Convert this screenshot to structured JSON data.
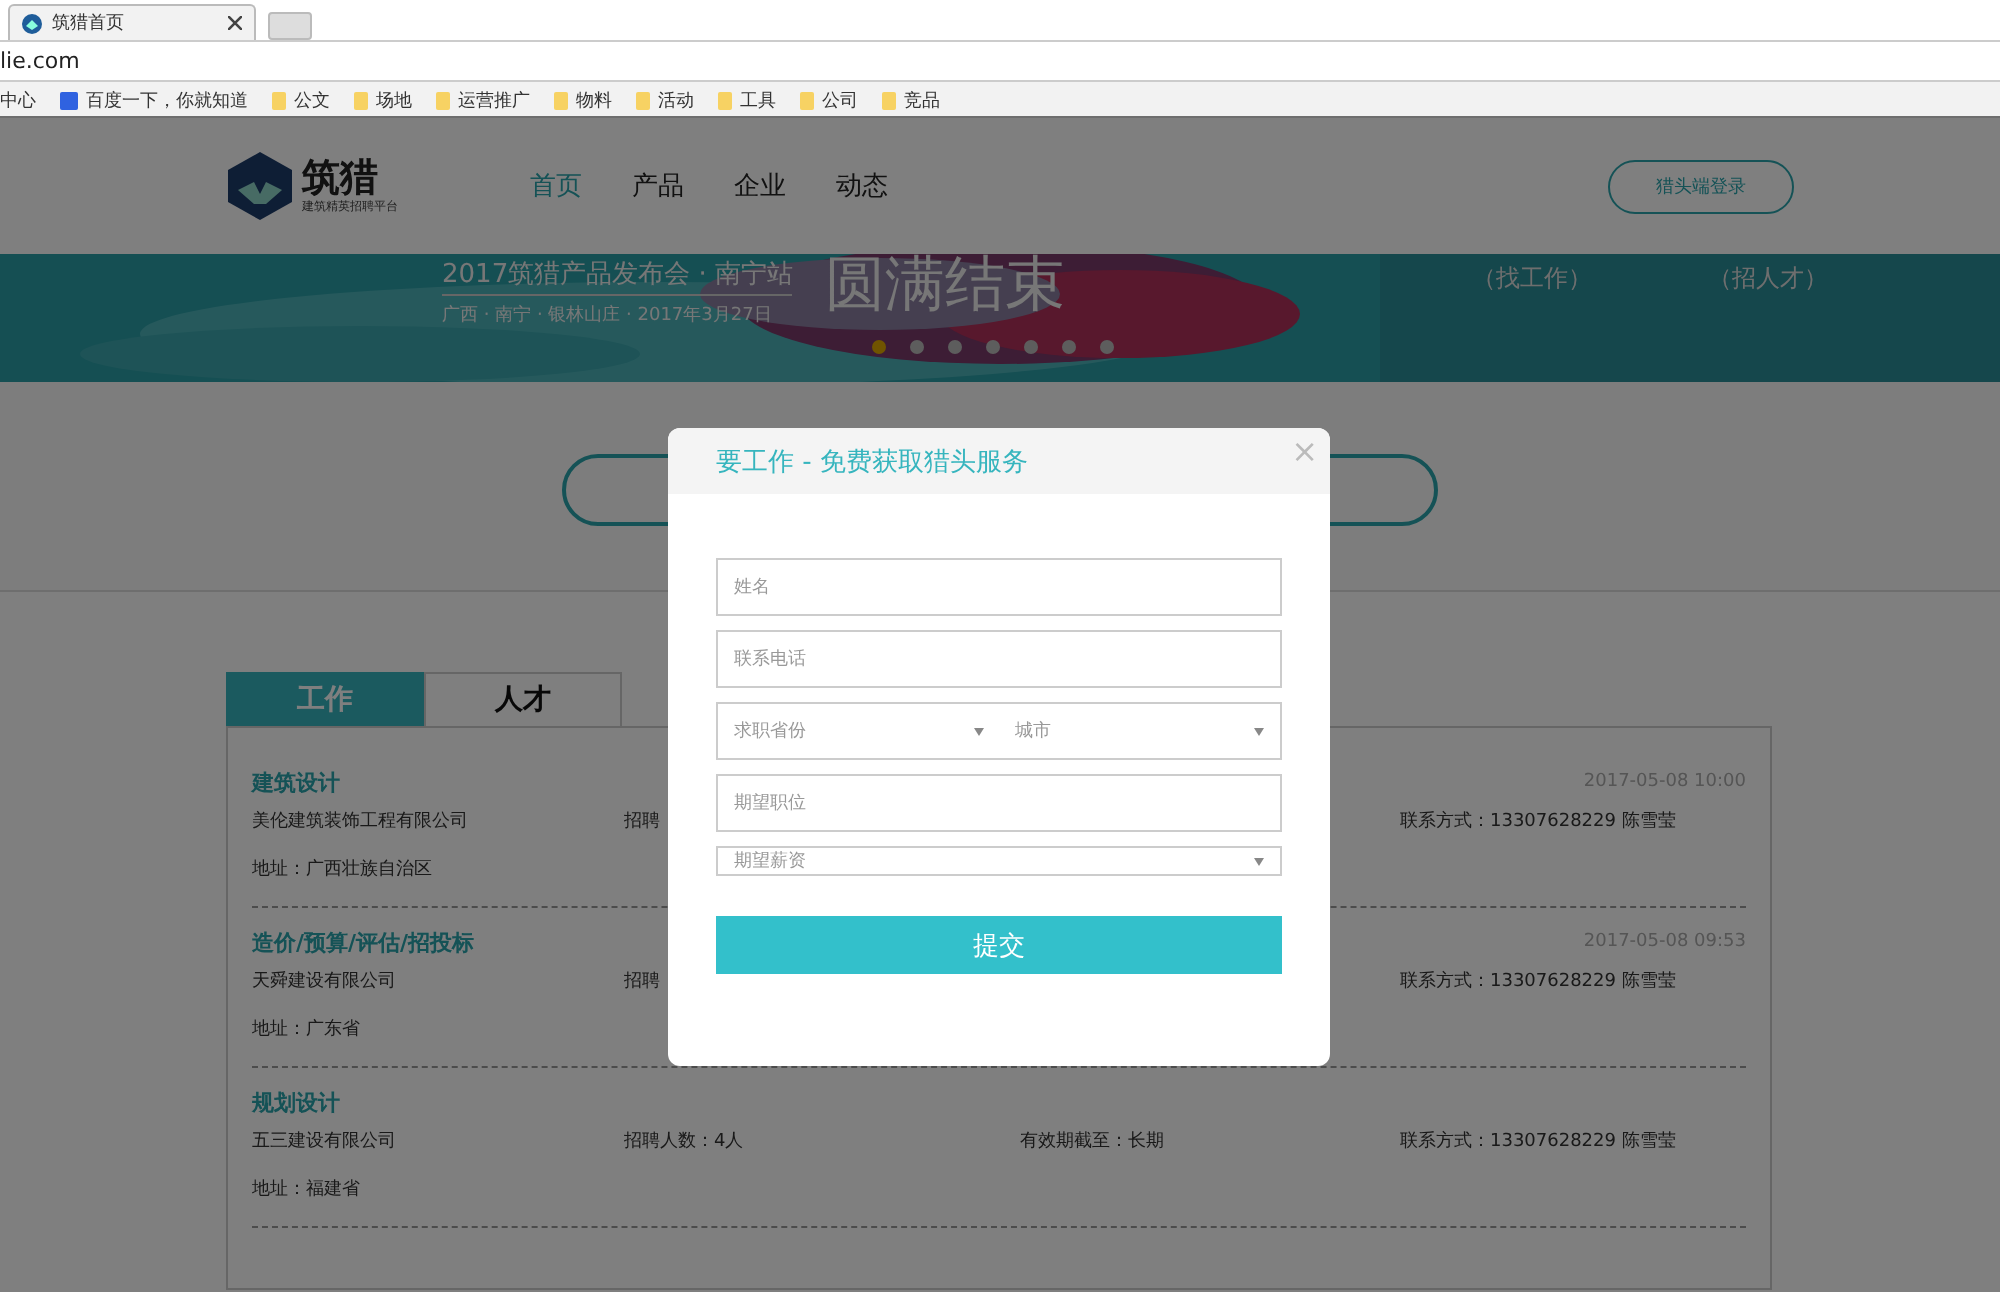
{
  "browser": {
    "tab_title": "筑猎首页",
    "address": "lie.com",
    "bookmarks": [
      {
        "label": "中心",
        "kind": "plain"
      },
      {
        "label": "百度一下，你就知道",
        "kind": "paw"
      },
      {
        "label": "公文",
        "kind": "folder"
      },
      {
        "label": "场地",
        "kind": "folder"
      },
      {
        "label": "运营推广",
        "kind": "folder"
      },
      {
        "label": "物料",
        "kind": "folder"
      },
      {
        "label": "活动",
        "kind": "folder"
      },
      {
        "label": "工具",
        "kind": "folder"
      },
      {
        "label": "公司",
        "kind": "folder"
      },
      {
        "label": "竞品",
        "kind": "folder"
      }
    ]
  },
  "header": {
    "logo_text": "筑猎",
    "logo_sub": "建筑精英招聘平台",
    "nav": [
      {
        "label": "首页",
        "selected": true
      },
      {
        "label": "产品",
        "selected": false
      },
      {
        "label": "企业",
        "selected": false
      },
      {
        "label": "动态",
        "selected": false
      }
    ],
    "login": "猎头端登录"
  },
  "banner": {
    "title": "2017筑猎产品发布会 · 南宁站",
    "subtitle": "广西 · 南宁 · 银林山庄 · 2017年3月27日",
    "headline": "圆满结束",
    "links": [
      "（找工作）",
      "（招人才）"
    ],
    "dots": [
      {
        "selected": true
      },
      {
        "selected": false
      },
      {
        "selected": false
      },
      {
        "selected": false
      },
      {
        "selected": false
      },
      {
        "selected": false
      },
      {
        "selected": false
      }
    ]
  },
  "tabs": [
    {
      "label": "工作",
      "selected": true
    },
    {
      "label": "人才",
      "selected": false
    }
  ],
  "jobs": [
    {
      "title": "建筑设计",
      "date": "2017-05-08 10:00",
      "company": "美伦建筑装饰工程有限公司",
      "count": "招聘",
      "contact": "联系方式：13307628229 陈雪莹",
      "address": "地址：广西壮族自治区"
    },
    {
      "title": "造价/预算/评估/招投标",
      "date": "2017-05-08 09:53",
      "company": "天舜建设有限公司",
      "count": "招聘",
      "contact": "联系方式：13307628229 陈雪莹",
      "address": "地址：广东省"
    },
    {
      "title": "规划设计",
      "company": "五三建设有限公司",
      "count": "招聘人数：4人",
      "valid": "有效期截至：长期",
      "contact": "联系方式：13307628229 陈雪莹",
      "address": "地址：福建省"
    }
  ],
  "modal": {
    "title": "要工作 - 免费获取猎头服务",
    "close": "×",
    "fields": [
      {
        "kind": "input",
        "placeholder": "姓名"
      },
      {
        "kind": "input",
        "placeholder": "联系电话"
      },
      {
        "kind": "pair",
        "placeholders": [
          "求职省份",
          "城市"
        ]
      },
      {
        "kind": "input",
        "placeholder": "期望职位"
      },
      {
        "kind": "select",
        "placeholder": "期望薪资"
      }
    ],
    "submit": "提交"
  }
}
